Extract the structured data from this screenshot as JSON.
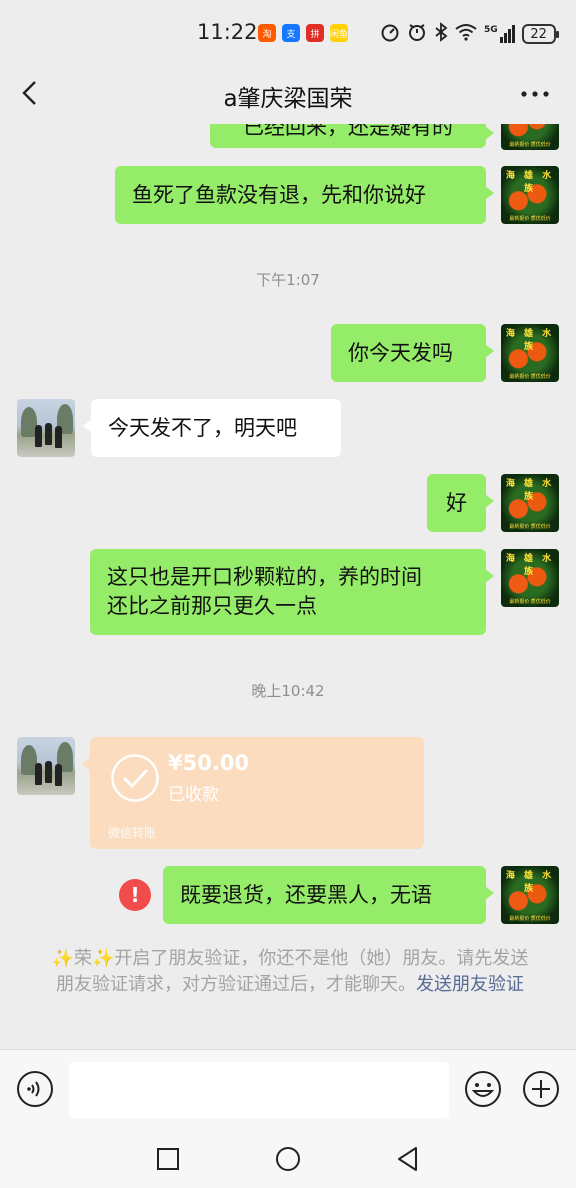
{
  "status_bar": {
    "time": "11:22",
    "apps": [
      {
        "name": "taobao-app-icon",
        "color": "#ff5a00",
        "label": "淘"
      },
      {
        "name": "alipay-app-icon",
        "color": "#1677ff",
        "label": "支"
      },
      {
        "name": "pinduoduo-app-icon",
        "color": "#e02e24",
        "label": "拼"
      },
      {
        "name": "xianyu-app-icon",
        "color": "#ffd200",
        "label": "闲鱼"
      }
    ],
    "network": "5G",
    "battery": "22"
  },
  "nav": {
    "title": "a肇庆梁国荣"
  },
  "avatar_me": {
    "top_text": "海 雄 水 族",
    "bottom_text": "最新报价  质优低价"
  },
  "messages": {
    "m0": "已经回来，还是疑有的",
    "m1": "鱼死了鱼款没有退，先和你说好",
    "t1": "下午1:07",
    "m2": "你今天发吗",
    "m3": "今天发不了，明天吧",
    "m4": "好",
    "m5_line1": "这只也是开口秒颗粒的，养的时间",
    "m5_line2": "还比之前那只更久一点",
    "t2": "晚上10:42",
    "m6": "既要退货，还要黑人，无语"
  },
  "transfer": {
    "amount": "¥50.00",
    "status": "已收款",
    "source": "微信转账"
  },
  "system_note": {
    "text": "✨荣✨开启了朋友验证，你还不是他（她）朋友。请先发送朋友验证请求，对方验证通过后，才能聊天。",
    "link": "发送朋友验证"
  },
  "failed_icon": "!",
  "colors": {
    "my_bubble": "#95ec69",
    "their_bubble": "#ffffff",
    "transfer": "#fbdcbf",
    "error": "#f14b4b",
    "link": "#576b95"
  }
}
